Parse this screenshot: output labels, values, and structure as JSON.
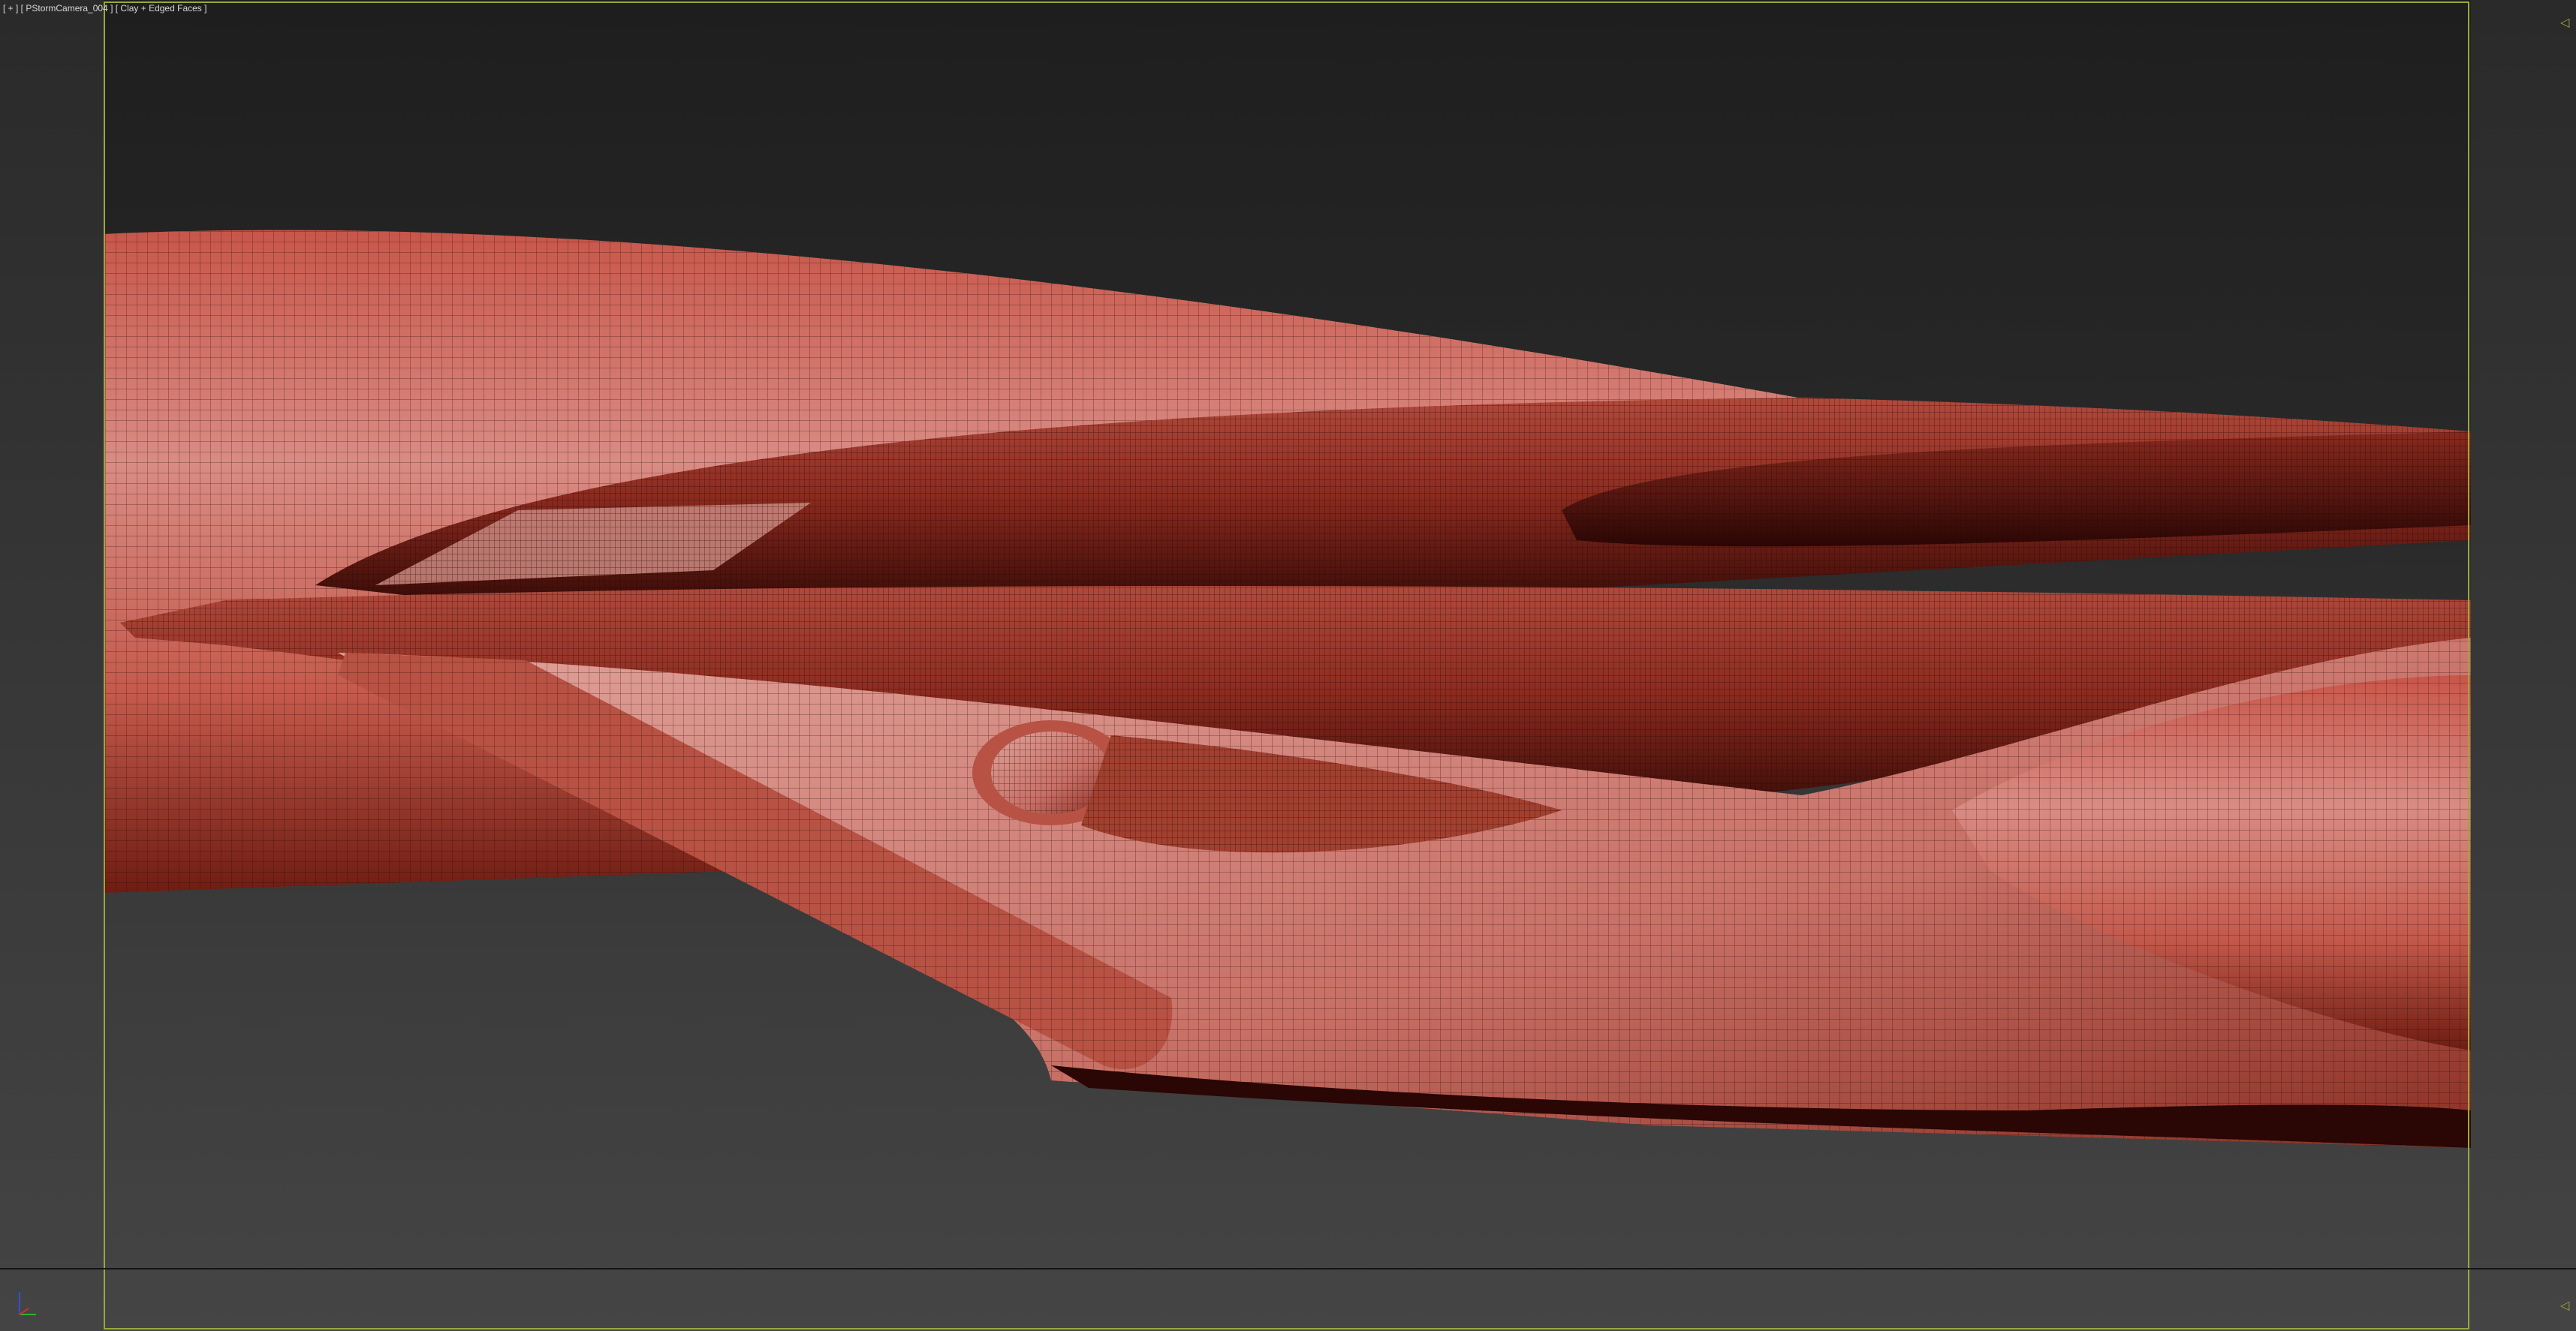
{
  "viewport": {
    "label": "[ + ] [ PStormCamera_004 ] [ Clay + Edged Faces ]",
    "shading_mode": "Clay + Edged Faces",
    "camera": "PStormCamera_004"
  },
  "colors": {
    "mesh_light": "#d98c84",
    "mesh_mid": "#b04a3c",
    "mesh_dark": "#3a0c08",
    "background_top": "#1e1e1e",
    "background_bottom": "#454545",
    "safe_frame": "#9aa83a",
    "axis_x": "#d03030",
    "axis_y": "#30b030",
    "axis_z": "#3050d0"
  },
  "icons": {
    "axis_gizmo": "xyz-axis-tripod-icon",
    "frame_marker": "triangle-marker-icon"
  }
}
